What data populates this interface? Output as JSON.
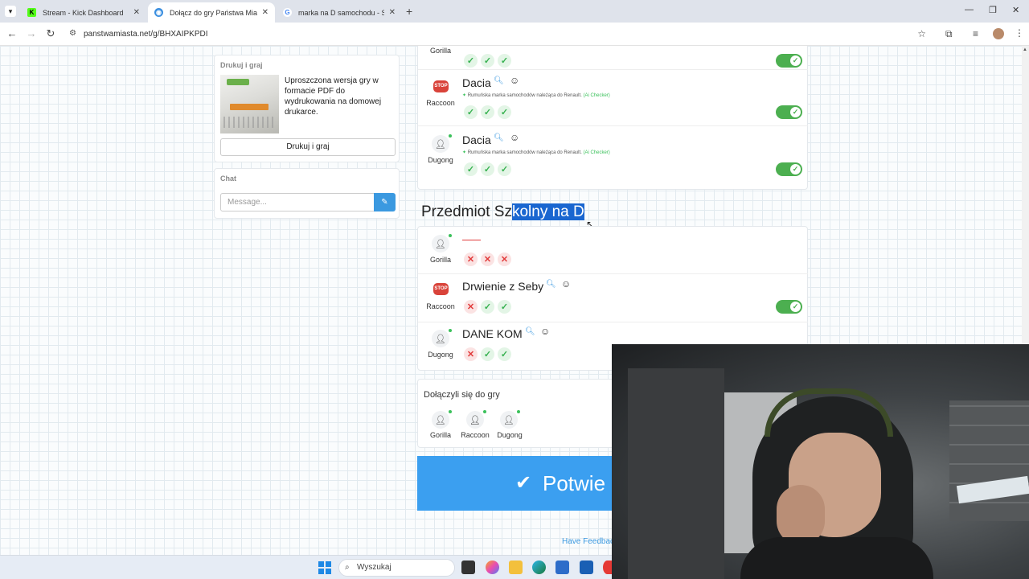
{
  "browser": {
    "tabs": [
      {
        "title": "Stream - Kick Dashboard",
        "icon": "kick-icon"
      },
      {
        "title": "Dołącz do gry Państwa Miasta",
        "icon": "globe-icon"
      },
      {
        "title": "marka na D samochodu - Szukaj",
        "icon": "google-icon"
      }
    ],
    "url": "panstwamiasta.net/g/BHXAIPKPDI"
  },
  "sidebar": {
    "print_title": "Drukuj i graj",
    "print_desc": "Uproszczona wersja gry w formacie PDF do wydrukowania na domowej drukarce.",
    "print_button": "Drukuj i graj",
    "chat_title": "Chat",
    "chat_placeholder": "Message..."
  },
  "category1": {
    "rows": [
      {
        "player": "Gorilla",
        "answer": "",
        "note": "",
        "marks": [
          "ok",
          "ok",
          "ok"
        ],
        "toggle": true
      },
      {
        "player": "Raccoon",
        "answer": "Dacia",
        "note": "Rumuńska marka samochodów należąca do Renault.",
        "checker": "(Ai Checker)",
        "marks": [
          "ok",
          "ok",
          "ok"
        ],
        "toggle": true
      },
      {
        "player": "Dugong",
        "answer": "Dacia",
        "note": "Rumuńska marka samochodów należąca do Renault.",
        "checker": "(Ai Checker)",
        "marks": [
          "ok",
          "ok",
          "ok"
        ],
        "toggle": true
      }
    ]
  },
  "category2": {
    "title_plain": "Przedmiot Sz",
    "title_selected": "kolny na D",
    "rows": [
      {
        "player": "Gorilla",
        "answer": "",
        "marks": [
          "no",
          "no",
          "no"
        ],
        "toggle": false
      },
      {
        "player": "Raccoon",
        "answer": "Drwienie z Seby",
        "marks": [
          "no",
          "ok",
          "ok"
        ],
        "toggle": true
      },
      {
        "player": "Dugong",
        "answer": "DANE KOM",
        "marks": [
          "no",
          "ok",
          "ok"
        ],
        "toggle": false
      }
    ]
  },
  "joined": {
    "title": "Dołączyli się do gry",
    "players": [
      "Gorilla",
      "Raccoon",
      "Dugong"
    ]
  },
  "confirm_label": "Potwie",
  "feedback": "Have Feedbac",
  "taskbar": {
    "search": "Wyszukaj"
  },
  "colors": {
    "accent": "#3b99e0",
    "ok": "#36b14f",
    "error": "#e13b3b"
  }
}
